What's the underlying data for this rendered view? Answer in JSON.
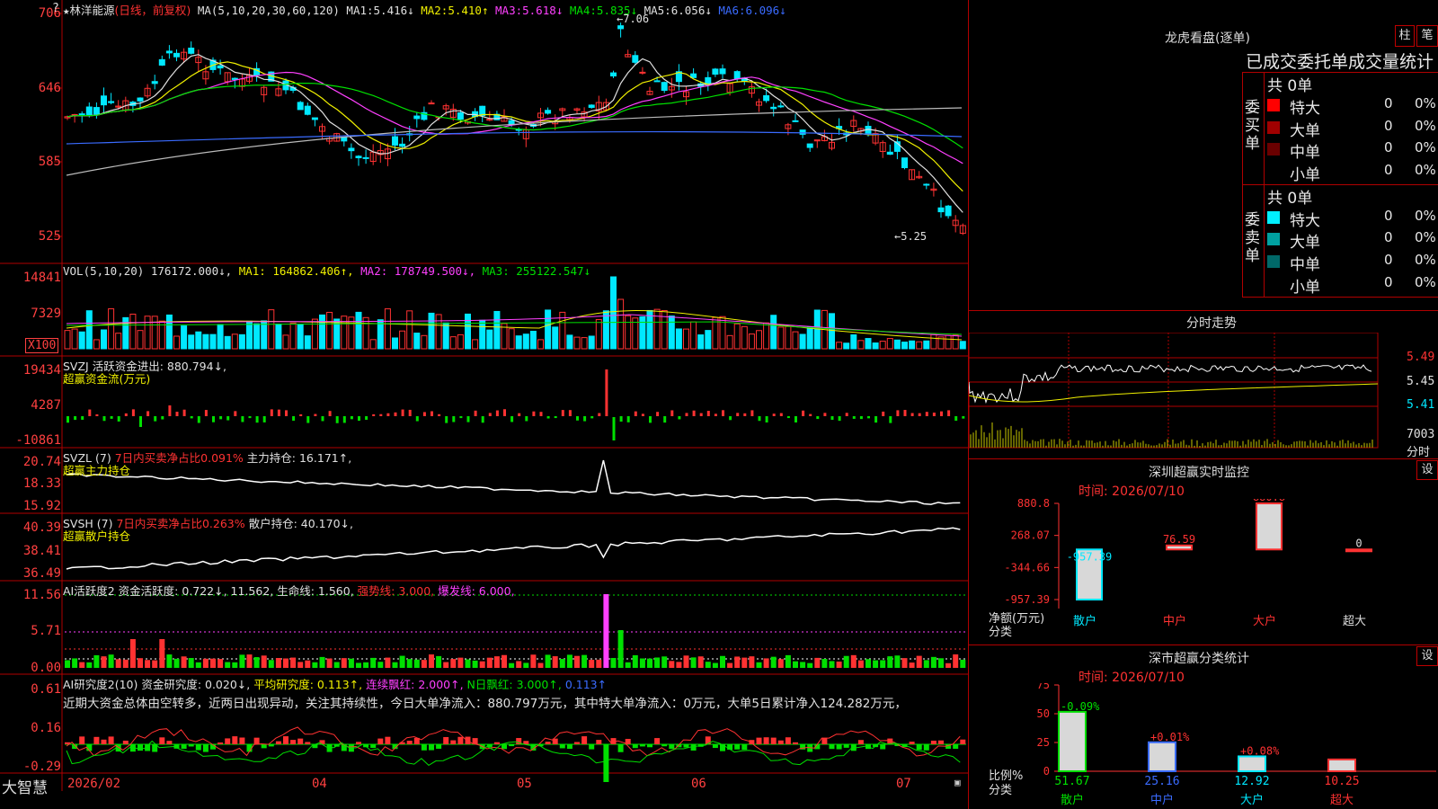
{
  "main": {
    "title": "林洋能源",
    "mode": "(日线，前复权)",
    "ma_label": "MA(5,10,20,30,60,120)",
    "ma": [
      {
        "label": "MA1:",
        "value": "5.416↓",
        "color": "#e0e0e0"
      },
      {
        "label": "MA2:",
        "value": "5.410↑",
        "color": "#f0f000"
      },
      {
        "label": "MA3:",
        "value": "5.618↓",
        "color": "#ff40ff"
      },
      {
        "label": "MA4:",
        "value": "5.835↓",
        "color": "#00e000"
      },
      {
        "label": "MA5:",
        "value": "6.056↓",
        "color": "#e0e0e0"
      },
      {
        "label": "MA6:",
        "value": "6.096↓",
        "color": "#3a6bff"
      }
    ],
    "high_label": "7.06",
    "low_label": "5.25",
    "y_ticks": [
      "706",
      "646",
      "585",
      "525"
    ]
  },
  "vol": {
    "header": "VOL(5,10,20)",
    "value": "176172.000↓,",
    "ma1": "MA1: 164862.406↑,",
    "ma2": "MA2: 178749.500↓,",
    "ma3": "MA3: 255122.547↓",
    "y_ticks": [
      "14841",
      "7329"
    ],
    "unit": "X100"
  },
  "svzj": {
    "header": "SVZJ  活跃资金进出: 880.794↓,",
    "sub": "超赢资金流(万元)",
    "y_ticks": [
      "19434",
      "4287",
      "-10861"
    ]
  },
  "svzl": {
    "header_a": "SVZL (7)",
    "header_b": "7日内买卖净占比0.091%",
    "header_c": "主力持仓: 16.171↑,",
    "sub": "超赢主力持仓",
    "y_ticks": [
      "20.74",
      "18.33",
      "15.92"
    ]
  },
  "svsh": {
    "header_a": "SVSH (7)",
    "header_b": "7日内买卖净占比0.263%",
    "header_c": "散户持仓: 40.170↓,",
    "sub": "超赢散户持仓",
    "y_ticks": [
      "40.39",
      "38.41",
      "36.49"
    ]
  },
  "ai1": {
    "header_a": "AI活跃度2 资金活跃度: 0.722↓, 11.562, 生命线: 1.560,",
    "header_b": "强势线: 3.000,",
    "header_c": "爆发线: 6.000,",
    "y_ticks": [
      "11.56",
      "5.71",
      "0.00"
    ]
  },
  "ai2": {
    "header_a": "AI研究度2(10) 资金研究度: 0.020↓,",
    "header_b": "平均研究度: 0.113↑,",
    "header_c": "连续飘红: 2.000↑,",
    "header_d": "N日飘红: 3.000↑,",
    "header_e": "0.113↑",
    "comment": "近期大资金总体由空转多，近两日出现异动，关注其持续性，今日大单净流入：880.797万元，其中特大单净流入：0万元，大单5日累计净入124.282万元，",
    "y_ticks": [
      "0.61",
      "0.16",
      "-0.29"
    ]
  },
  "xaxis": {
    "labels": [
      "2026/02",
      "04",
      "05",
      "06",
      "07"
    ],
    "brand": "大智慧"
  },
  "dragon": {
    "title": "龙虎看盘(逐单)",
    "btn_bar": "柱",
    "btn_pen": "笔",
    "subtitle": "已成交委托单成交量统计",
    "buy": {
      "side": "委买单",
      "total": "共 0单",
      "rows": [
        {
          "name": "特大",
          "count": "0",
          "pct": "0%",
          "color": "#ff0000"
        },
        {
          "name": "大单",
          "count": "0",
          "pct": "0%",
          "color": "#a00000"
        },
        {
          "name": "中单",
          "count": "0",
          "pct": "0%",
          "color": "#6a0000"
        },
        {
          "name": "小单",
          "count": "0",
          "pct": "0%",
          "color": ""
        }
      ]
    },
    "sell": {
      "side": "委卖单",
      "total": "共 0单",
      "rows": [
        {
          "name": "特大",
          "count": "0",
          "pct": "0%",
          "color": "#00f0ff"
        },
        {
          "name": "大单",
          "count": "0",
          "pct": "0%",
          "color": "#00a0a0"
        },
        {
          "name": "中单",
          "count": "0",
          "pct": "0%",
          "color": "#006868"
        },
        {
          "name": "小单",
          "count": "0",
          "pct": "0%",
          "color": ""
        }
      ]
    }
  },
  "intraday": {
    "title": "分时走势",
    "y_ticks": [
      "5.49",
      "5.45",
      "5.41"
    ],
    "vol_label": "7003",
    "sub_label": "分时"
  },
  "monitor": {
    "title": "深圳超赢实时监控",
    "btn": "设",
    "time": "时间: 2026/07/10",
    "y_ticks": [
      "880.8",
      "268.07",
      "-344.66",
      "-957.39"
    ],
    "unit_a": "净额(万元)",
    "unit_b": "分类",
    "categories": [
      "散户",
      "中户",
      "大户",
      "超大"
    ],
    "chart_data": {
      "type": "bar",
      "categories": [
        "散户",
        "中户",
        "大户",
        "超大"
      ],
      "values": [
        -957.39,
        76.59,
        880.8,
        0
      ],
      "ylim": [
        -957.39,
        880.8
      ]
    },
    "value_labels": [
      "-957.39",
      "76.59",
      "880.8",
      "0"
    ]
  },
  "classify": {
    "title": "深市超赢分类统计",
    "btn": "设",
    "time": "时间: 2026/07/10",
    "y_ticks": [
      "75",
      "50",
      "25",
      "0"
    ],
    "unit_a": "比例%",
    "unit_b": "分类",
    "categories": [
      "散户",
      "中户",
      "大户",
      "超大"
    ],
    "chart_data": {
      "type": "bar",
      "categories": [
        "散户",
        "中户",
        "大户",
        "超大"
      ],
      "values": [
        51.67,
        25.16,
        12.92,
        10.25
      ],
      "ylim": [
        0,
        75
      ]
    },
    "change_labels": [
      "-0.09%",
      "+0.01%",
      "+0.08%",
      ""
    ],
    "value_labels": [
      "51.67",
      "25.16",
      "12.92",
      "10.25"
    ]
  },
  "colors": {
    "up": "#ff3232",
    "down": "#00e8ff",
    "grid": "#b00000"
  }
}
